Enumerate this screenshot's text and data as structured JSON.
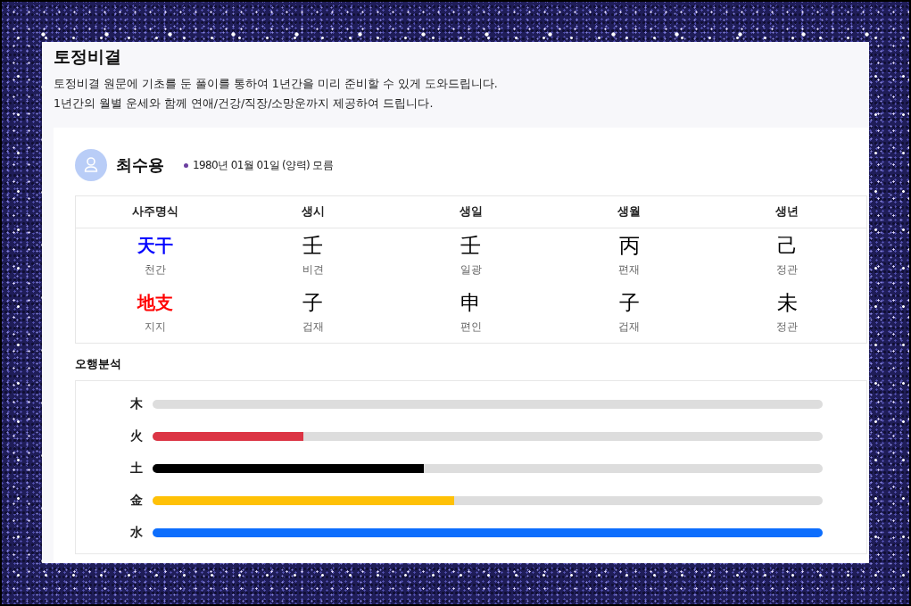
{
  "header": {
    "title": "토정비결",
    "description": [
      "토정비결 원문에 기초를 둔 풀이를 통하여 1년간을 미리 준비할 수 있게 도와드립니다.",
      "1년간의 월별 운세와 함께 연애/건강/직장/소망운까지 제공하여 드립니다."
    ]
  },
  "profile": {
    "name": "최수용",
    "birth": "1980년 01월 01일 (양력) 모름"
  },
  "saju_table": {
    "columns": [
      "사주명식",
      "생시",
      "생일",
      "생월",
      "생년"
    ],
    "rows": [
      {
        "cells": [
          {
            "char": "天干",
            "name": "천간",
            "color": "#0000ff"
          },
          {
            "char": "壬",
            "name": "비견"
          },
          {
            "char": "壬",
            "name": "일광"
          },
          {
            "char": "丙",
            "name": "편재"
          },
          {
            "char": "己",
            "name": "정관"
          }
        ]
      },
      {
        "cells": [
          {
            "char": "地支",
            "name": "지지",
            "color": "#ff0000"
          },
          {
            "char": "子",
            "name": "겁재"
          },
          {
            "char": "申",
            "name": "편인"
          },
          {
            "char": "子",
            "name": "겁재"
          },
          {
            "char": "未",
            "name": "정관"
          }
        ]
      }
    ]
  },
  "five_elements": {
    "title": "오행분석",
    "elements": [
      {
        "label": "木",
        "level": 0
      },
      {
        "label": "火",
        "level": 0.225,
        "color": "#dc3545"
      },
      {
        "label": "土",
        "level": 0.405,
        "color": "#000000"
      },
      {
        "label": "金",
        "level": 0.45,
        "color": "#ffc107"
      },
      {
        "label": "水",
        "level": 1,
        "color": "#0d6efd"
      }
    ]
  }
}
